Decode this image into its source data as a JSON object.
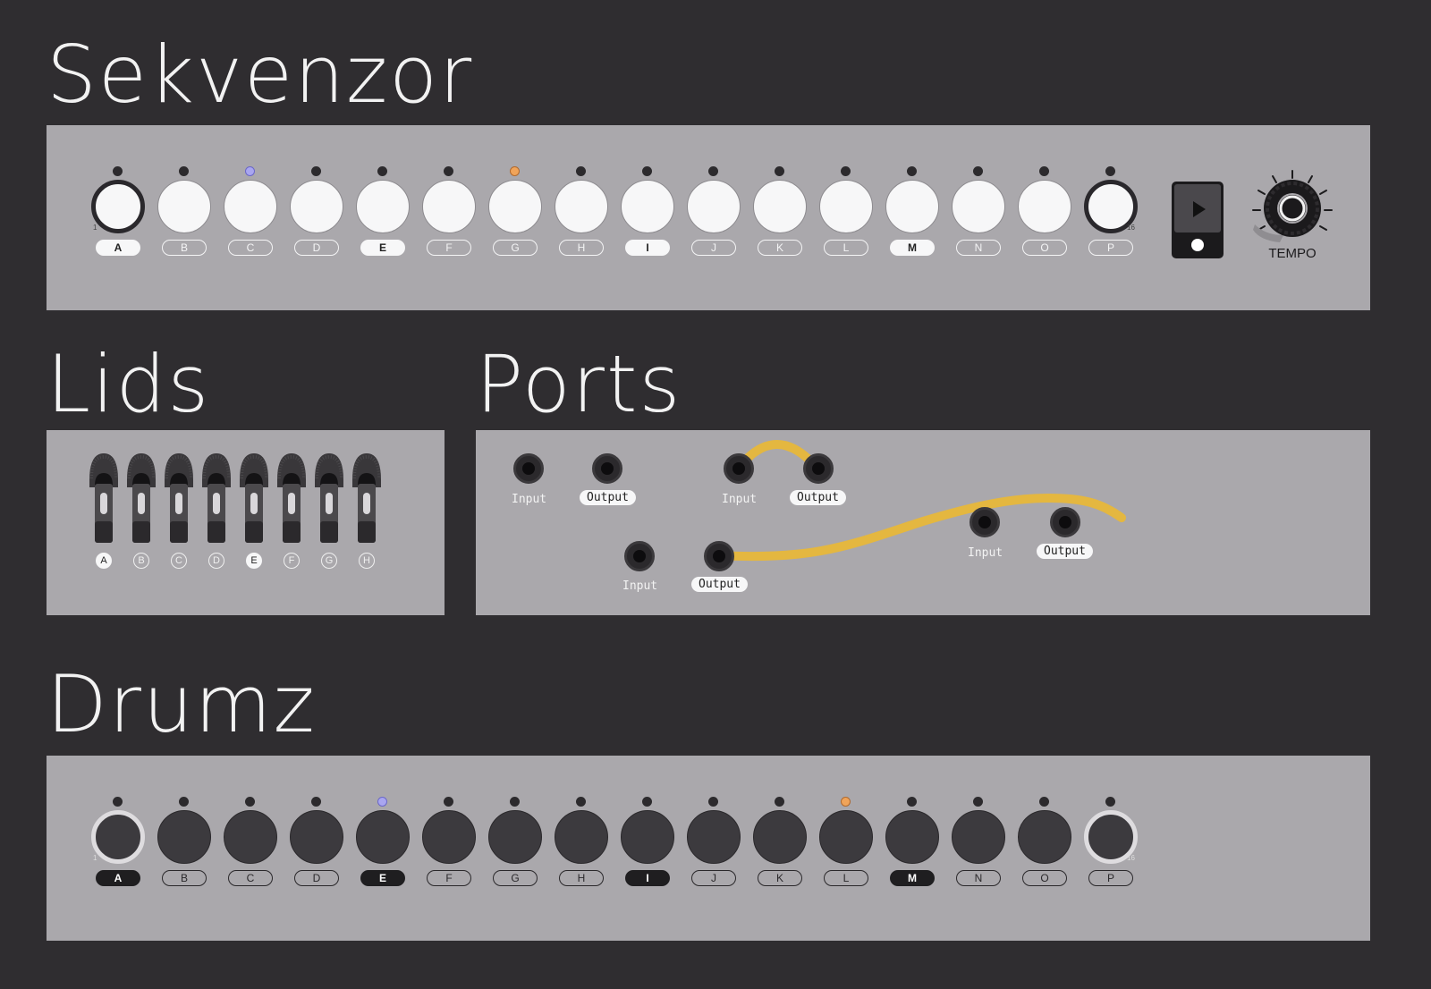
{
  "headings": {
    "sequencer": "Sekvenzor",
    "lids": "Lids",
    "ports": "Ports",
    "drums": "Drumz"
  },
  "colors": {
    "background": "#2f2d30",
    "panel": "#aaa8ac",
    "cable": "#e7b73a",
    "led_purple": "#a9a6f0",
    "led_orange": "#f0a45a"
  },
  "sequencer": {
    "steps": [
      {
        "label": "A",
        "active": true,
        "led": "off",
        "first_num": "1"
      },
      {
        "label": "B",
        "active": false,
        "led": "off"
      },
      {
        "label": "C",
        "active": false,
        "led": "purple"
      },
      {
        "label": "D",
        "active": false,
        "led": "off"
      },
      {
        "label": "E",
        "active": true,
        "led": "off"
      },
      {
        "label": "F",
        "active": false,
        "led": "off"
      },
      {
        "label": "G",
        "active": false,
        "led": "orange"
      },
      {
        "label": "H",
        "active": false,
        "led": "off"
      },
      {
        "label": "I",
        "active": true,
        "led": "off"
      },
      {
        "label": "J",
        "active": false,
        "led": "off"
      },
      {
        "label": "K",
        "active": false,
        "led": "off"
      },
      {
        "label": "L",
        "active": false,
        "led": "off"
      },
      {
        "label": "M",
        "active": true,
        "led": "off"
      },
      {
        "label": "N",
        "active": false,
        "led": "off"
      },
      {
        "label": "O",
        "active": false,
        "led": "off"
      },
      {
        "label": "P",
        "active": false,
        "led": "off",
        "last_num": "16"
      }
    ],
    "play_icon": "play-icon",
    "tempo_label": "TEMPO"
  },
  "lids": {
    "items": [
      {
        "label": "A",
        "active": true
      },
      {
        "label": "B",
        "active": false
      },
      {
        "label": "C",
        "active": false
      },
      {
        "label": "D",
        "active": false
      },
      {
        "label": "E",
        "active": true
      },
      {
        "label": "F",
        "active": false
      },
      {
        "label": "G",
        "active": false
      },
      {
        "label": "H",
        "active": false
      }
    ]
  },
  "ports": {
    "input_label": "Input",
    "output_label": "Output"
  },
  "drums": {
    "steps": [
      {
        "label": "A",
        "active": true,
        "led": "off",
        "first_num": "1"
      },
      {
        "label": "B",
        "active": false,
        "led": "off"
      },
      {
        "label": "C",
        "active": false,
        "led": "off"
      },
      {
        "label": "D",
        "active": false,
        "led": "off"
      },
      {
        "label": "E",
        "active": true,
        "led": "purple"
      },
      {
        "label": "F",
        "active": false,
        "led": "off"
      },
      {
        "label": "G",
        "active": false,
        "led": "off"
      },
      {
        "label": "H",
        "active": false,
        "led": "off"
      },
      {
        "label": "I",
        "active": true,
        "led": "off"
      },
      {
        "label": "J",
        "active": false,
        "led": "off"
      },
      {
        "label": "K",
        "active": false,
        "led": "off"
      },
      {
        "label": "L",
        "active": false,
        "led": "orange"
      },
      {
        "label": "M",
        "active": true,
        "led": "off"
      },
      {
        "label": "N",
        "active": false,
        "led": "off"
      },
      {
        "label": "O",
        "active": false,
        "led": "off"
      },
      {
        "label": "P",
        "active": false,
        "led": "off",
        "last_num": "16"
      }
    ]
  }
}
